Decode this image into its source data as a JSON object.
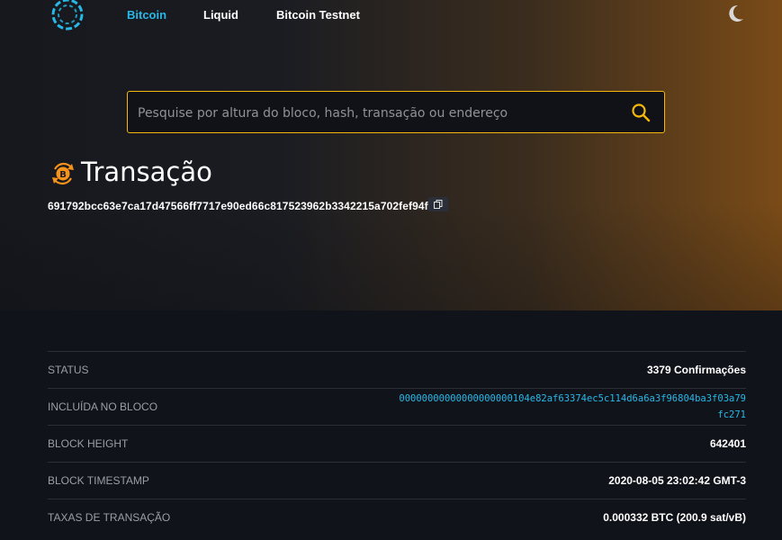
{
  "nav": {
    "items": [
      {
        "label": "Bitcoin",
        "active": true
      },
      {
        "label": "Liquid",
        "active": false
      },
      {
        "label": "Bitcoin Testnet",
        "active": false
      }
    ]
  },
  "search": {
    "placeholder": "Pesquise por altura do bloco, hash, transação ou endereço",
    "value": ""
  },
  "transaction": {
    "title": "Transação",
    "txid": "691792bcc63e7ca17d47566ff7717e90ed66c817523962b3342215a702fef94f"
  },
  "details": [
    {
      "label": "Status",
      "value": "3379 Confirmações",
      "link": false
    },
    {
      "label": "Incluída no bloco",
      "value": "00000000000000000000104e82af63374ec5c114d6a6a3f96804ba3f03a79fc271",
      "link": true
    },
    {
      "label": "Block height",
      "value": "642401",
      "link": false
    },
    {
      "label": "Block timestamp",
      "value": "2020-08-05 23:02:42 GMT-3",
      "link": false
    },
    {
      "label": "Taxas de transação",
      "value": "0.000332 BTC (200.9 sat/vB)",
      "link": false
    }
  ],
  "colors": {
    "accent_link": "#27b8e8",
    "search_border": "#f5b80a",
    "bitcoin_orange": "#f7931a",
    "hero_gradient_end": "#7a4b17"
  },
  "icons": {
    "logo": "blockstream-logo-icon",
    "theme": "moon-icon",
    "search": "search-icon",
    "transaction": "bitcoin-transaction-icon",
    "copy": "copy-icon"
  }
}
